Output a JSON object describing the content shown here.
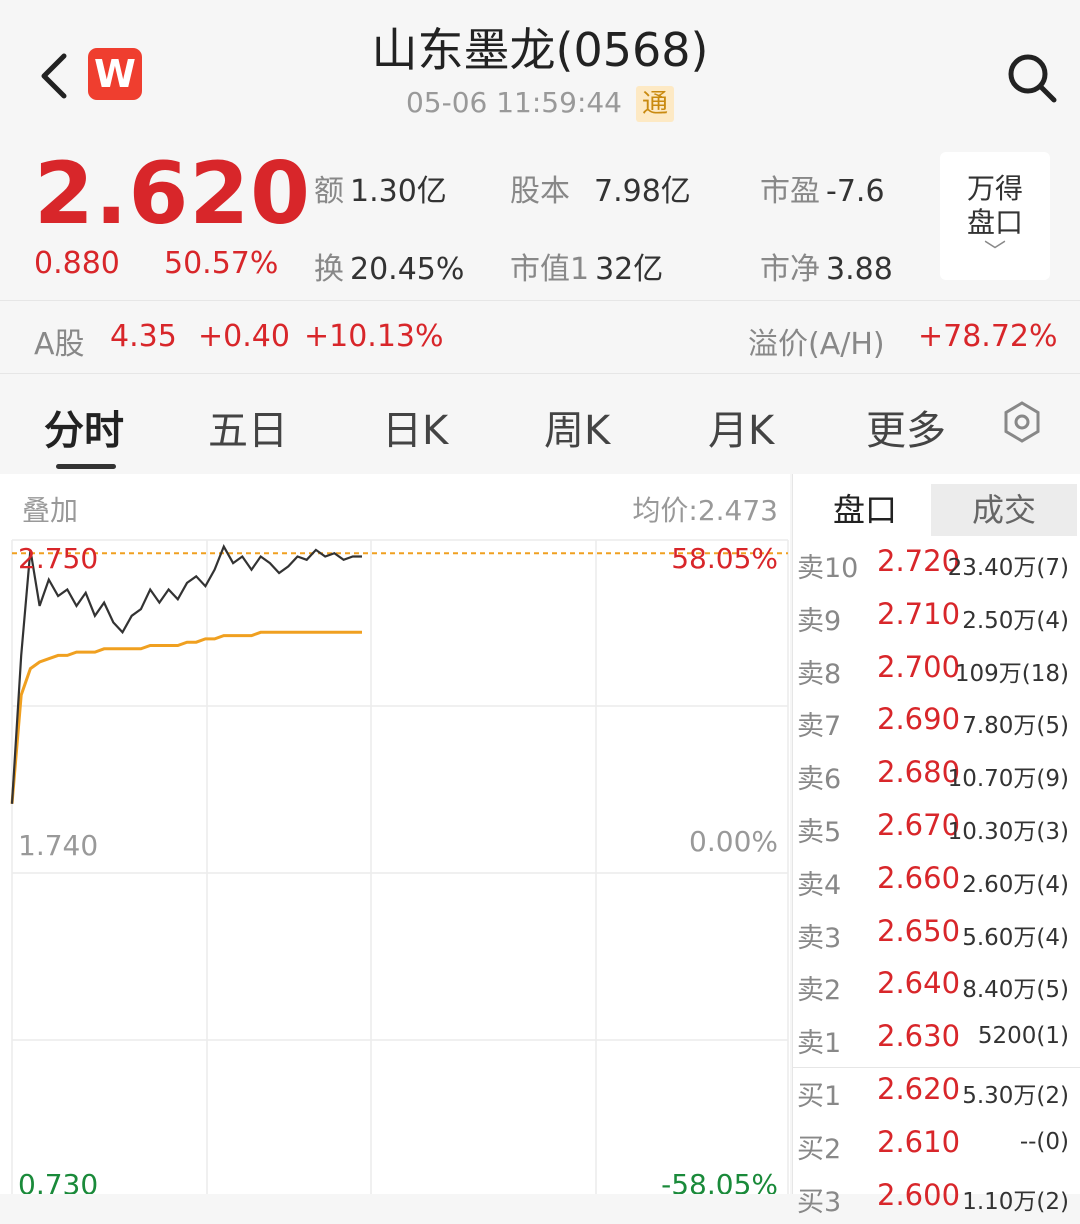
{
  "header": {
    "title": "山东墨龙(0568)",
    "datetime": "05-06 11:59:44",
    "badge": "通",
    "logo_letter": "W"
  },
  "quote": {
    "price": "2.620",
    "change": "0.880",
    "change_pct": "50.57%",
    "stats": [
      {
        "label": "额",
        "value": "1.30亿"
      },
      {
        "label": "股本",
        "value": "7.98亿"
      },
      {
        "label": "市盈",
        "value": "-7.6"
      },
      {
        "label": "换",
        "value": "20.45%"
      },
      {
        "label": "市值1",
        "value": "32亿"
      },
      {
        "label": "市净",
        "value": "3.88"
      }
    ],
    "wind_button": {
      "line1": "万得",
      "line2": "盘口",
      "chevron": "﹀"
    }
  },
  "a_share": {
    "label": "A股",
    "price": "4.35",
    "change": "+0.40",
    "change_pct": "+10.13%",
    "premium_label": "溢价(A/H)",
    "premium_value": "+78.72%"
  },
  "tabs": [
    "分时",
    "五日",
    "日K",
    "周K",
    "月K",
    "更多"
  ],
  "active_tab": "分时",
  "chart": {
    "overlay_label": "叠加",
    "avg_label": "均价:2.473",
    "y_top": "2.750",
    "y_mid": "1.740",
    "y_bot": "0.730",
    "pct_top": "58.05%",
    "pct_mid": "0.00%",
    "pct_bot": "-58.05%"
  },
  "chart_data": {
    "type": "line",
    "ylim": [
      0.73,
      2.75
    ],
    "prev_close": 1.74,
    "series": [
      {
        "values": [
          1.95,
          2.4,
          2.72,
          2.55,
          2.63,
          2.58,
          2.6,
          2.55,
          2.59,
          2.52,
          2.56,
          2.5,
          2.47,
          2.52,
          2.54,
          2.6,
          2.56,
          2.6,
          2.57,
          2.62,
          2.64,
          2.61,
          2.66,
          2.73,
          2.68,
          2.7,
          2.66,
          2.7,
          2.68,
          2.65,
          2.67,
          2.7,
          2.69,
          2.72,
          2.7,
          2.71,
          2.69,
          2.7,
          2.7
        ]
      },
      {
        "values": [
          1.95,
          2.28,
          2.36,
          2.38,
          2.39,
          2.4,
          2.4,
          2.41,
          2.41,
          2.41,
          2.42,
          2.42,
          2.42,
          2.42,
          2.42,
          2.43,
          2.43,
          2.43,
          2.43,
          2.44,
          2.44,
          2.45,
          2.45,
          2.46,
          2.46,
          2.46,
          2.46,
          2.47,
          2.47,
          2.47,
          2.47,
          2.47,
          2.47,
          2.47,
          2.47,
          2.47,
          2.47,
          2.47,
          2.47
        ]
      }
    ]
  },
  "book": {
    "tabs": [
      "盘口",
      "成交"
    ],
    "rows": [
      {
        "name": "卖10",
        "price": "2.720",
        "vol": "23.40万(7)"
      },
      {
        "name": "卖9",
        "price": "2.710",
        "vol": "2.50万(4)"
      },
      {
        "name": "卖8",
        "price": "2.700",
        "vol": "109万(18)"
      },
      {
        "name": "卖7",
        "price": "2.690",
        "vol": "7.80万(5)"
      },
      {
        "name": "卖6",
        "price": "2.680",
        "vol": "10.70万(9)"
      },
      {
        "name": "卖5",
        "price": "2.670",
        "vol": "10.30万(3)"
      },
      {
        "name": "卖4",
        "price": "2.660",
        "vol": "2.60万(4)"
      },
      {
        "name": "卖3",
        "price": "2.650",
        "vol": "5.60万(4)"
      },
      {
        "name": "卖2",
        "price": "2.640",
        "vol": "8.40万(5)"
      },
      {
        "name": "卖1",
        "price": "2.630",
        "vol": "5200(1)"
      },
      {
        "name": "买1",
        "price": "2.620",
        "vol": "5.30万(2)"
      },
      {
        "name": "买2",
        "price": "2.610",
        "vol": "--(0)"
      },
      {
        "name": "买3",
        "price": "2.600",
        "vol": "1.10万(2)"
      }
    ]
  },
  "colors": {
    "up": "#d8262a",
    "down": "#1a8a3a",
    "price_line": "#333333",
    "avg_line": "#f0a020",
    "ref_line": "#f0a020"
  }
}
